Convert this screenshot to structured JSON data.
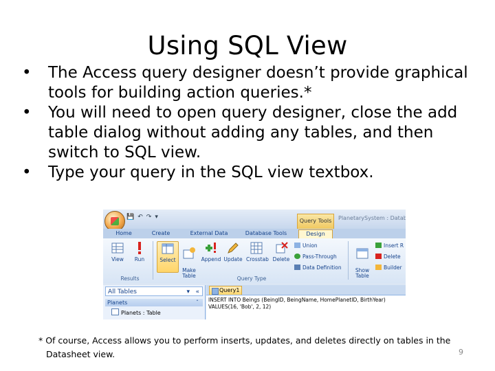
{
  "slide": {
    "title": "Using SQL View",
    "bullets": [
      "The Access query designer doesn’t provide graphical tools for building action queries.*",
      "You will need to open query designer, close the add table dialog without adding any tables, and then switch to SQL view.",
      "Type your query in the SQL view textbox."
    ],
    "footnote_line1": "* Of course, Access allows you to perform inserts, updates, and deletes directly on tables in the",
    "footnote_line2": "Datasheet view.",
    "page_number": "9"
  },
  "access": {
    "context_tab": "Query Tools",
    "app_title": "PlanetarySystem : Datab",
    "tabs": [
      "Home",
      "Create",
      "External Data",
      "Database Tools",
      "Design"
    ],
    "ribbon": {
      "view": "View",
      "run": "Run",
      "select": "Select",
      "make_table": "Make\nTable",
      "append": "Append",
      "update": "Update",
      "crosstab": "Crosstab",
      "delete": "Delete",
      "union": "Union",
      "pass_through": "Pass-Through",
      "data_definition": "Data Definition",
      "show_table": "Show\nTable",
      "insert_rows": "Insert R",
      "delete_rows": "Delete",
      "builder": "Builder",
      "group_results": "Results",
      "group_query_type": "Query Type"
    },
    "nav": {
      "header": "All Tables",
      "group": "Planets",
      "item": "Planets : Table"
    },
    "document": {
      "tab": "Query1",
      "sql_line1": "INSERT INTO Beings (BeingID, BeingName, HomePlanetID, BirthYear)",
      "sql_line2": "VALUES(16, 'Bob', 2, 12)"
    },
    "colors": {
      "ribbon_text": "#15428b",
      "selected_gold": "#ffd56a",
      "ribbon_blue": "#dbe6f4"
    }
  }
}
